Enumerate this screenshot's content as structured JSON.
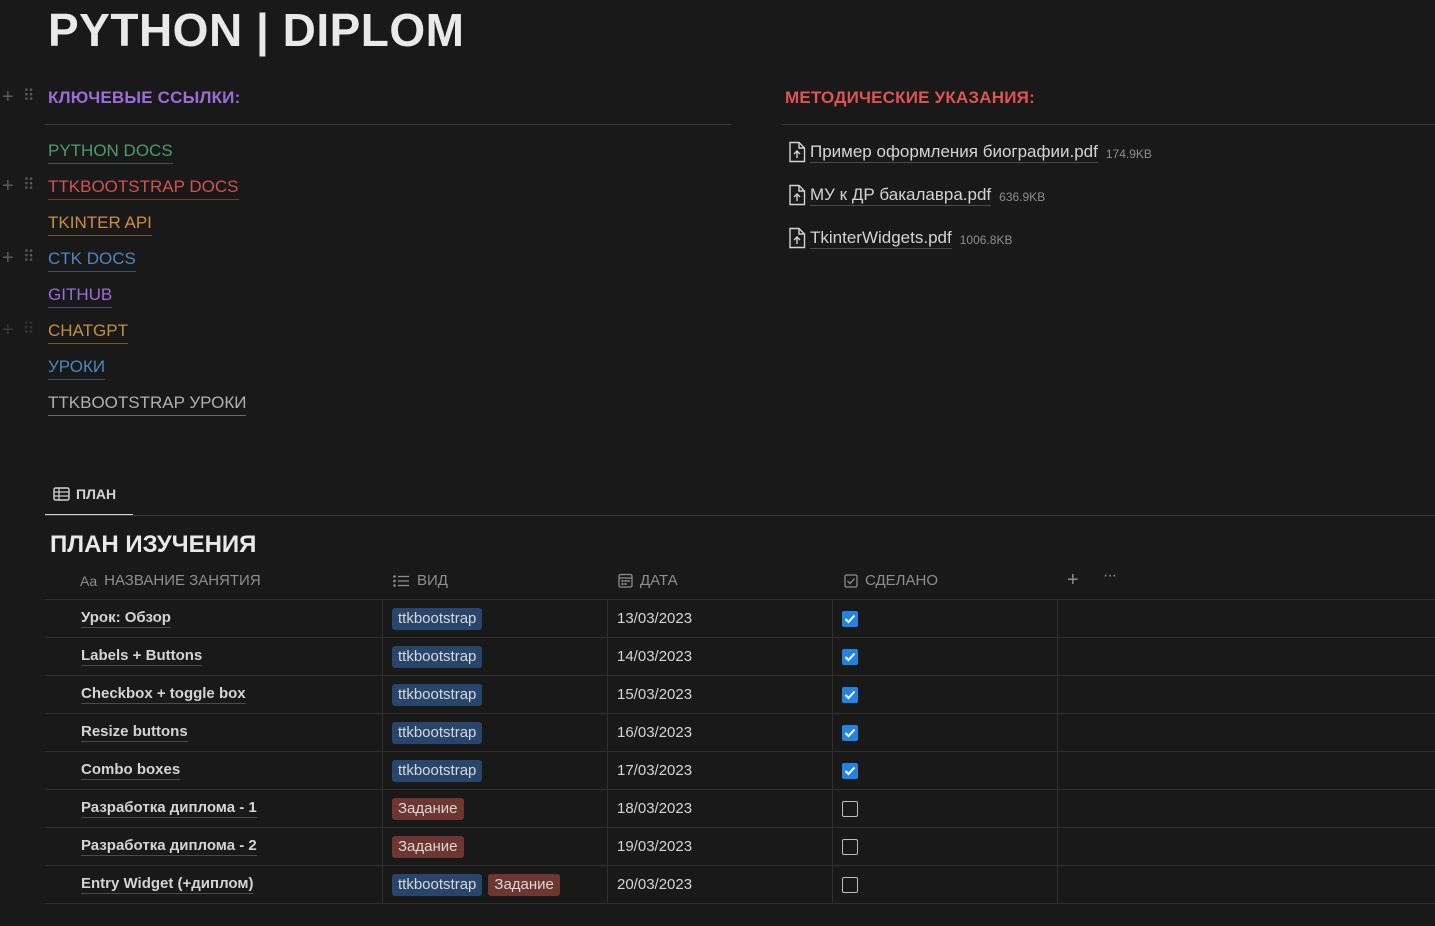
{
  "page": {
    "title": "PYTHON | DIPLOM"
  },
  "links_section": {
    "heading": "КЛЮЧЕВЫЕ ССЫЛКИ:",
    "links": [
      {
        "label": "PYTHON DOCS",
        "color": "#4e9b6b"
      },
      {
        "label": "TTKBOOTSTRAP DOCS",
        "color": "#d25250"
      },
      {
        "label": "TKINTER API",
        "color": "#d08c40"
      },
      {
        "label": "CTK DOCS",
        "color": "#4f86c0"
      },
      {
        "label": "GITHUB",
        "color": "#9a6dd7"
      },
      {
        "label": "CHATGPT",
        "color": "#c19138"
      },
      {
        "label": "УРОКИ",
        "color": "#4f86c0"
      },
      {
        "label": "TTKBOOTSTRAP УРОКИ",
        "color": "#b0b0b0"
      }
    ]
  },
  "docs_section": {
    "heading": "МЕТОДИЧЕСКИЕ УКАЗАНИЯ:",
    "files": [
      {
        "name": "Пример оформления биографии.pdf",
        "size": "174.9KB"
      },
      {
        "name": "МУ к ДР бакалавра.pdf",
        "size": "636.9KB"
      },
      {
        "name": "TkinterWidgets.pdf",
        "size": "1006.8KB"
      }
    ]
  },
  "view_tab": {
    "label": "ПЛАН",
    "icon": "table-icon"
  },
  "database": {
    "title": "ПЛАН ИЗУЧЕНИЯ",
    "columns": [
      {
        "label": "НАЗВАНИЕ ЗАНЯТИЯ",
        "icon": "Aa"
      },
      {
        "label": "ВИД",
        "icon": "list-icon"
      },
      {
        "label": "ДАТА",
        "icon": "calendar-icon"
      },
      {
        "label": "СДЕЛАНО",
        "icon": "checkbox-icon"
      }
    ],
    "add_column": "+",
    "more": "···",
    "rows": [
      {
        "name": "Урок: Обзор",
        "tags": [
          {
            "label": "ttkbootstrap",
            "color": "blue"
          }
        ],
        "date": "13/03/2023",
        "done": true
      },
      {
        "name": "Labels + Buttons",
        "tags": [
          {
            "label": "ttkbootstrap",
            "color": "blue"
          }
        ],
        "date": "14/03/2023",
        "done": true
      },
      {
        "name": "Checkbox + toggle box",
        "tags": [
          {
            "label": "ttkbootstrap",
            "color": "blue"
          }
        ],
        "date": "15/03/2023",
        "done": true
      },
      {
        "name": "Resize buttons",
        "tags": [
          {
            "label": "ttkbootstrap",
            "color": "blue"
          }
        ],
        "date": "16/03/2023",
        "done": true
      },
      {
        "name": "Combo boxes",
        "tags": [
          {
            "label": "ttkbootstrap",
            "color": "blue"
          }
        ],
        "date": "17/03/2023",
        "done": true
      },
      {
        "name": "Разработка диплома - 1",
        "tags": [
          {
            "label": "Задание",
            "color": "red"
          }
        ],
        "date": "18/03/2023",
        "done": false
      },
      {
        "name": "Разработка диплома - 2",
        "tags": [
          {
            "label": "Задание",
            "color": "red"
          }
        ],
        "date": "19/03/2023",
        "done": false
      },
      {
        "name": "Entry Widget (+диплом)",
        "tags": [
          {
            "label": "ttkbootstrap",
            "color": "blue"
          },
          {
            "label": "Задание",
            "color": "red"
          }
        ],
        "date": "20/03/2023",
        "done": false
      }
    ]
  }
}
